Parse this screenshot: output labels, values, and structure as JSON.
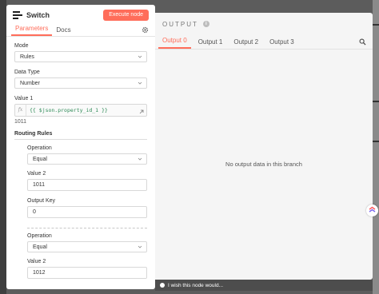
{
  "node": {
    "title": "Switch",
    "execute_label": "Execute node",
    "tabs": [
      "Parameters",
      "Docs"
    ]
  },
  "params": {
    "mode_label": "Mode",
    "mode_value": "Rules",
    "data_type_label": "Data Type",
    "data_type_value": "Number",
    "value1_label": "Value 1",
    "value1_expr": "{{ $json.property_id_1 }}",
    "value1_hint": "1011",
    "routing_rules_label": "Routing Rules",
    "rules": [
      {
        "operation_label": "Operation",
        "operation_value": "Equal",
        "value2_label": "Value 2",
        "value2": "1011",
        "output_key_label": "Output Key",
        "output_key": "0"
      },
      {
        "operation_label": "Operation",
        "operation_value": "Equal",
        "value2_label": "Value 2",
        "value2": "1012"
      }
    ]
  },
  "output": {
    "title": "OUTPUT",
    "tabs": [
      "Output 0",
      "Output 1",
      "Output 2",
      "Output 3"
    ],
    "empty_message": "No output data in this branch"
  },
  "feedback": "I wish this node would...",
  "icons": [
    "switch-icon",
    "gear-icon",
    "chevron-down-icon",
    "expand-icon",
    "info-icon",
    "search-icon",
    "lightbulb-icon",
    "clickup-icon"
  ],
  "colors": {
    "accent": "#ff6d5a",
    "expression": "#2e8b57"
  }
}
